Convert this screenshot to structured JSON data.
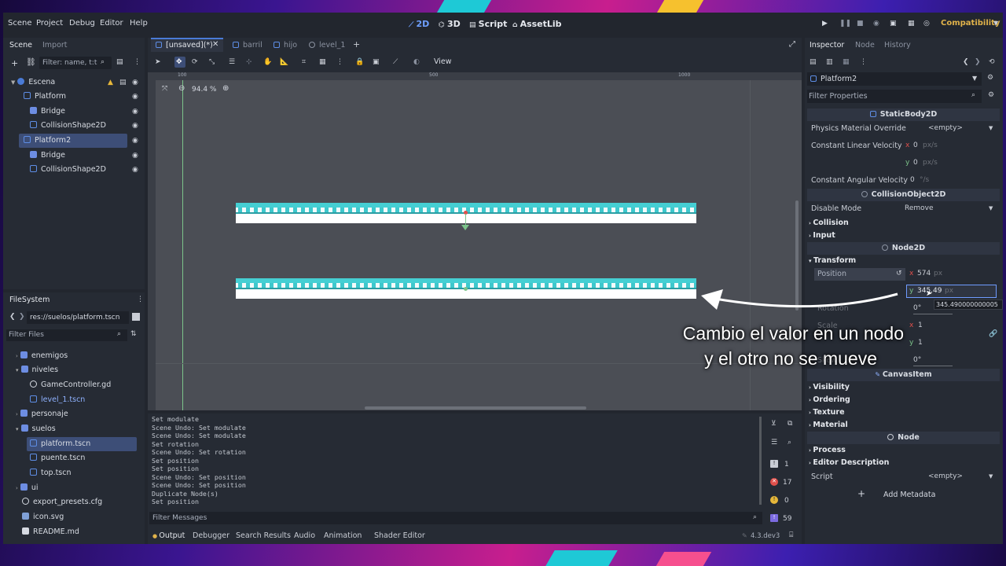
{
  "menubar": {
    "items": [
      "Scene",
      "Project",
      "Debug",
      "Editor",
      "Help"
    ]
  },
  "workspaces": {
    "items": [
      "2D",
      "3D",
      "Script",
      "AssetLib"
    ]
  },
  "renderer": "Compatibility",
  "scene_dock": {
    "tabs": [
      "Scene",
      "Import"
    ],
    "filter_placeholder": "Filter: name, t:t",
    "tree": [
      {
        "label": "Escena",
        "indent": 0
      },
      {
        "label": "Platform",
        "indent": 1
      },
      {
        "label": "Bridge",
        "indent": 2
      },
      {
        "label": "CollisionShape2D",
        "indent": 2
      },
      {
        "label": "Platform2",
        "indent": 1
      },
      {
        "label": "Bridge",
        "indent": 2
      },
      {
        "label": "CollisionShape2D",
        "indent": 2
      }
    ]
  },
  "filesystem": {
    "title": "FileSystem",
    "path": "res://suelos/platform.tscn",
    "filter_placeholder": "Filter Files",
    "items": [
      "enemigos",
      "GameController.gd",
      "niveles",
      "level_1.tscn",
      "personaje",
      "suelos",
      "platform.tscn",
      "puente.tscn",
      "top.tscn",
      "ui",
      "export_presets.cfg",
      "icon.svg",
      "README.md"
    ]
  },
  "scene_tabs": [
    "[unsaved](*)",
    "barril",
    "hijo",
    "level_1"
  ],
  "viewport": {
    "view_label": "View",
    "zoom": "94.4 %",
    "ruler_marks": [
      "100",
      "500",
      "1000"
    ]
  },
  "output": {
    "lines": [
      "Set modulate",
      "Scene Undo: Set modulate",
      "Scene Undo: Set modulate",
      "Set rotation",
      "Scene Undo: Set rotation",
      "Set position",
      "Set position",
      "Scene Undo: Set position",
      "Scene Undo: Set position",
      "Duplicate Node(s)",
      "Set position"
    ],
    "filter_placeholder": "Filter Messages",
    "counts": {
      "log": "1",
      "errors": "17",
      "warnings": "0",
      "messages": "59"
    },
    "bottom_tabs": [
      "Output",
      "Debugger",
      "Search Results",
      "Audio",
      "Animation",
      "Shader Editor"
    ],
    "version": "4.3.dev3"
  },
  "inspector": {
    "tabs": [
      "Inspector",
      "Node",
      "History"
    ],
    "node_name": "Platform2",
    "filter_placeholder": "Filter Properties",
    "static_body": "StaticBody2D",
    "physics_material_label": "Physics Material Override",
    "physics_material_value": "<empty>",
    "lin_vel_label": "Constant Linear Velocity",
    "lin_vel_x": "0",
    "lin_vel_y": "0",
    "unit_px_s": "px/s",
    "ang_vel_label": "Constant Angular Velocity",
    "ang_vel_value": "0",
    "unit_deg_s": "°/s",
    "collision_object": "CollisionObject2D",
    "disable_mode_label": "Disable Mode",
    "disable_mode_value": "Remove",
    "collision": "Collision",
    "input": "Input",
    "node2d": "Node2D",
    "transform": "Transform",
    "position_label": "Position",
    "pos_x": "574",
    "pos_y": "345.49",
    "unit_px": "px",
    "tooltip": "345.490000000005",
    "rotation_label": "Rotation",
    "rotation_value": "0",
    "scale_label": "Scale",
    "scale_x": "1",
    "scale_y": "1",
    "skew_label": "Skew",
    "skew_value": "0",
    "deg": "°",
    "canvas_item": "CanvasItem",
    "visibility": "Visibility",
    "ordering": "Ordering",
    "texture": "Texture",
    "material": "Material",
    "node": "Node",
    "process": "Process",
    "editor_description": "Editor Description",
    "script_label": "Script",
    "script_value": "<empty>",
    "add_metadata": "Add Metadata"
  },
  "annotation": {
    "line1": "Cambio el valor en un nodo",
    "line2": "y el otro no se mueve"
  },
  "colors": {
    "accent": "#4a7bd6",
    "selection": "#3d4e77",
    "platform": "#3ec8cd",
    "error": "#e0504b",
    "warning": "#e6b73a"
  }
}
